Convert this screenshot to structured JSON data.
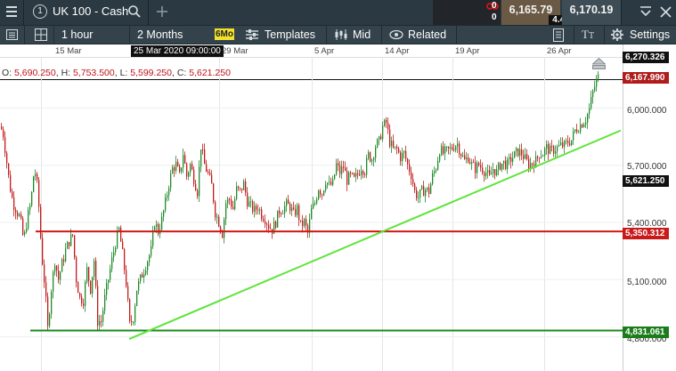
{
  "header": {
    "menu_icon": "hamburger-icon",
    "instrument_number": "1",
    "instrument": "UK 100 - Cash",
    "search_icon": "search-icon",
    "add_icon": "plus-icon",
    "position": {
      "top": "0",
      "bottom": "0",
      "icon": "link-icon"
    },
    "sell_price": "6,165.79",
    "spread": "4.40",
    "buy_price": "6,170.19",
    "chevron_icon": "chevron-down-icon",
    "close_icon": "close-icon"
  },
  "toolbar": {
    "interval": "1 hour",
    "range": "2 Months",
    "range_badge": "6Mo",
    "templates": "Templates",
    "mid": "Mid",
    "related": "Related",
    "settings": "Settings"
  },
  "chart": {
    "crosshair_date": "25 Mar 2020 09:00:00",
    "ohlc": {
      "o_label": "O:",
      "o": "5,690.250",
      "h_label": "H:",
      "h": "5,753.500",
      "l_label": "L:",
      "l": "5,599.250",
      "c_label": "C:",
      "c": "5,621.250"
    },
    "badges": {
      "top": "6,270.326",
      "current": "6,167.990",
      "crosshair": "5,621.250",
      "resistance": "5,350.312",
      "support": "4,831.061"
    },
    "colors": {
      "up": "#1e8b2a",
      "down": "#c21b1b",
      "trendline": "#5fe43a",
      "resistance": "#d41515",
      "support": "#1a8a1a"
    }
  },
  "chart_data": {
    "type": "candlestick",
    "instrument": "UK 100 - Cash",
    "interval": "1 hour",
    "x_tick_labels": [
      "15 Mar",
      "29 Mar",
      "5 Apr",
      "14 Apr",
      "19 Apr",
      "26 Apr"
    ],
    "y_tick_labels": [
      "6,000.000",
      "5,700.000",
      "5,400.000",
      "5,100.000",
      "4,800.000"
    ],
    "ylim": [
      4770,
      6320
    ],
    "grid": true,
    "price_path": [
      [
        0,
        5900
      ],
      [
        3,
        5860
      ],
      [
        6,
        5750
      ],
      [
        10,
        5600
      ],
      [
        14,
        5500
      ],
      [
        18,
        5460
      ],
      [
        22,
        5420
      ],
      [
        26,
        5300
      ],
      [
        30,
        5420
      ],
      [
        34,
        5500
      ],
      [
        38,
        5690
      ],
      [
        42,
        5560
      ],
      [
        46,
        5240
      ],
      [
        50,
        5050
      ],
      [
        53,
        4840
      ],
      [
        57,
        5050
      ],
      [
        61,
        5200
      ],
      [
        65,
        5100
      ],
      [
        69,
        5180
      ],
      [
        73,
        5250
      ],
      [
        77,
        5300
      ],
      [
        81,
        5330
      ],
      [
        85,
        5100
      ],
      [
        89,
        5000
      ],
      [
        93,
        4990
      ],
      [
        97,
        5150
      ],
      [
        101,
        5050
      ],
      [
        105,
        5200
      ],
      [
        109,
        4880
      ],
      [
        113,
        4880
      ],
      [
        117,
        5000
      ],
      [
        121,
        5100
      ],
      [
        125,
        5200
      ],
      [
        129,
        5290
      ],
      [
        133,
        5360
      ],
      [
        137,
        5230
      ],
      [
        141,
        5080
      ],
      [
        145,
        4860
      ],
      [
        149,
        4900
      ],
      [
        153,
        5050
      ],
      [
        157,
        5100
      ],
      [
        161,
        5150
      ],
      [
        165,
        5200
      ],
      [
        169,
        5250
      ],
      [
        173,
        5400
      ],
      [
        177,
        5350
      ],
      [
        181,
        5410
      ],
      [
        185,
        5500
      ],
      [
        189,
        5600
      ],
      [
        193,
        5680
      ],
      [
        197,
        5700
      ],
      [
        201,
        5640
      ],
      [
        205,
        5760
      ],
      [
        209,
        5640
      ],
      [
        213,
        5700
      ],
      [
        217,
        5630
      ],
      [
        221,
        5560
      ],
      [
        225,
        5800
      ],
      [
        229,
        5700
      ],
      [
        233,
        5650
      ],
      [
        237,
        5590
      ],
      [
        241,
        5450
      ],
      [
        245,
        5400
      ],
      [
        249,
        5340
      ],
      [
        253,
        5500
      ],
      [
        257,
        5520
      ],
      [
        261,
        5470
      ],
      [
        265,
        5570
      ],
      [
        269,
        5560
      ],
      [
        273,
        5600
      ],
      [
        277,
        5510
      ],
      [
        281,
        5480
      ],
      [
        285,
        5460
      ],
      [
        289,
        5480
      ],
      [
        293,
        5440
      ],
      [
        297,
        5420
      ],
      [
        301,
        5380
      ],
      [
        305,
        5360
      ],
      [
        309,
        5400
      ],
      [
        313,
        5460
      ],
      [
        317,
        5470
      ],
      [
        321,
        5490
      ],
      [
        325,
        5480
      ],
      [
        329,
        5440
      ],
      [
        333,
        5470
      ],
      [
        337,
        5380
      ],
      [
        341,
        5400
      ],
      [
        345,
        5340
      ],
      [
        349,
        5460
      ],
      [
        353,
        5500
      ],
      [
        357,
        5580
      ],
      [
        361,
        5550
      ],
      [
        365,
        5620
      ],
      [
        369,
        5590
      ],
      [
        373,
        5600
      ],
      [
        377,
        5700
      ],
      [
        381,
        5660
      ],
      [
        385,
        5690
      ],
      [
        389,
        5620
      ],
      [
        393,
        5640
      ],
      [
        397,
        5620
      ],
      [
        401,
        5650
      ],
      [
        405,
        5690
      ],
      [
        409,
        5670
      ],
      [
        413,
        5750
      ],
      [
        417,
        5730
      ],
      [
        421,
        5800
      ],
      [
        425,
        5820
      ],
      [
        429,
        5900
      ],
      [
        433,
        5920
      ],
      [
        437,
        5820
      ],
      [
        441,
        5780
      ],
      [
        445,
        5780
      ],
      [
        449,
        5740
      ],
      [
        453,
        5760
      ],
      [
        457,
        5700
      ],
      [
        461,
        5650
      ],
      [
        465,
        5560
      ],
      [
        469,
        5530
      ],
      [
        473,
        5560
      ],
      [
        477,
        5570
      ],
      [
        481,
        5560
      ],
      [
        485,
        5640
      ],
      [
        489,
        5690
      ],
      [
        493,
        5780
      ],
      [
        497,
        5760
      ],
      [
        501,
        5770
      ],
      [
        505,
        5780
      ],
      [
        509,
        5800
      ],
      [
        513,
        5810
      ],
      [
        517,
        5760
      ],
      [
        521,
        5720
      ],
      [
        525,
        5740
      ],
      [
        529,
        5700
      ],
      [
        533,
        5680
      ],
      [
        537,
        5700
      ],
      [
        541,
        5680
      ],
      [
        545,
        5660
      ],
      [
        549,
        5630
      ],
      [
        553,
        5680
      ],
      [
        557,
        5660
      ],
      [
        561,
        5700
      ],
      [
        565,
        5710
      ],
      [
        569,
        5700
      ],
      [
        573,
        5730
      ],
      [
        577,
        5750
      ],
      [
        581,
        5770
      ],
      [
        585,
        5760
      ],
      [
        589,
        5730
      ],
      [
        593,
        5700
      ],
      [
        597,
        5710
      ],
      [
        601,
        5720
      ],
      [
        605,
        5760
      ],
      [
        609,
        5760
      ],
      [
        613,
        5790
      ],
      [
        617,
        5770
      ],
      [
        621,
        5780
      ],
      [
        625,
        5790
      ],
      [
        629,
        5800
      ],
      [
        633,
        5800
      ],
      [
        637,
        5820
      ],
      [
        641,
        5830
      ],
      [
        645,
        5880
      ],
      [
        649,
        5900
      ],
      [
        653,
        5920
      ],
      [
        657,
        5940
      ],
      [
        661,
        5990
      ],
      [
        665,
        6080
      ],
      [
        669,
        6140
      ],
      [
        672,
        6168
      ]
    ],
    "horizontal_lines": [
      {
        "name": "resistance",
        "value": 5350.312
      },
      {
        "name": "support",
        "value": 4831.061
      }
    ],
    "trendline": {
      "from": [
        145,
        4786
      ],
      "to": [
        697,
        5880
      ]
    },
    "current_price": 6167.99,
    "top_marker": 6270.326,
    "crosshair_price": 5621.25
  }
}
